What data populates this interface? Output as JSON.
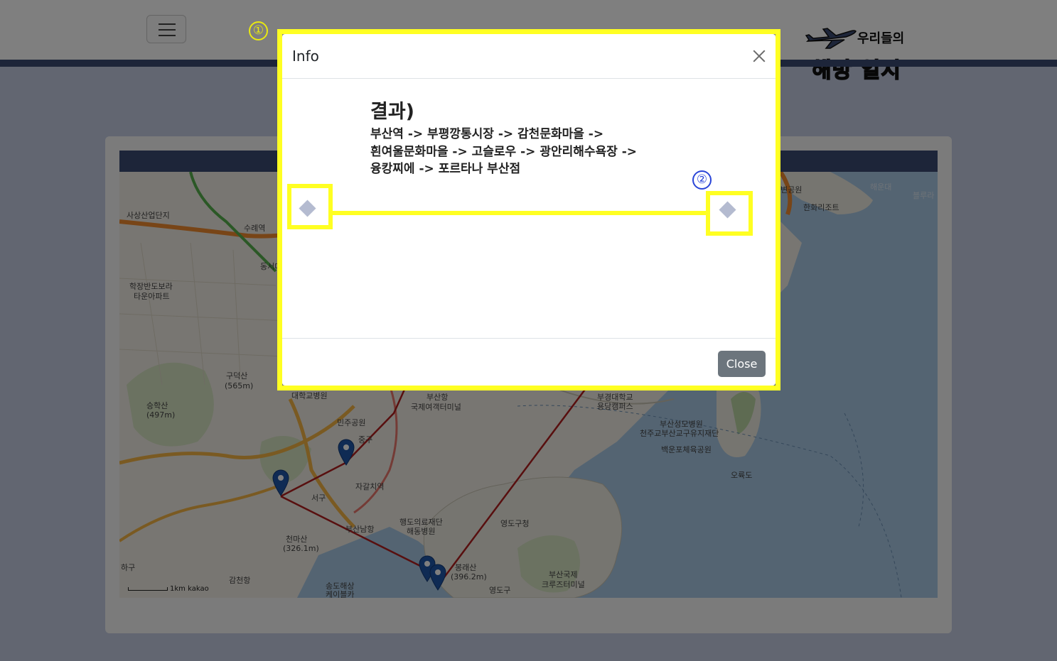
{
  "modal": {
    "title": "Info",
    "result_title": "결과)",
    "route_lines": [
      "부산역 -> 부평깡통시장 -> 감천문화마을 ->",
      "흰여울문화마을 -> 고슬로우 -> 광안리해수욕장 ->",
      "융캉찌에 -> 포르타나 부산점"
    ],
    "close_label": "Close"
  },
  "logo": {
    "top_text": "우리들의",
    "main_text": "해방 일지"
  },
  "annotations": {
    "marker_1": "①",
    "marker_2": "②"
  },
  "map": {
    "labels": [
      "사상산업단지",
      "수례역",
      "동서대",
      "학장반도보라",
      "타운아파트",
      "구덕산",
      "(565m)",
      "승학산",
      "(497m)",
      "대학교병원",
      "부산항",
      "국제여객터미널",
      "민주공원",
      "중구",
      "자갈치역",
      "서구",
      "부산남항",
      "행도의료재단",
      "해동병원",
      "영도구청",
      "천마산",
      "(326.1m)",
      "하구",
      "감천항",
      "송도해상",
      "케이블카",
      "봉래산",
      "(396.2m)",
      "영도구",
      "부산국제",
      "크루즈터미널",
      "부경대학교",
      "용당캠퍼스",
      "부산성모병원",
      "천주교부산교구유지재단",
      "백운포체육공원",
      "오륙도",
      "한화리조트",
      "해운대",
      "변공원",
      "블루라",
      "kakao",
      "1km"
    ],
    "marker_icon": "map-pin-icon"
  },
  "colors": {
    "highlight": "#ffff22",
    "header_bar": "#3b4a72",
    "close_button": "#6c757d",
    "route_line": "#b01e1e",
    "marker": "#1f56a8"
  }
}
